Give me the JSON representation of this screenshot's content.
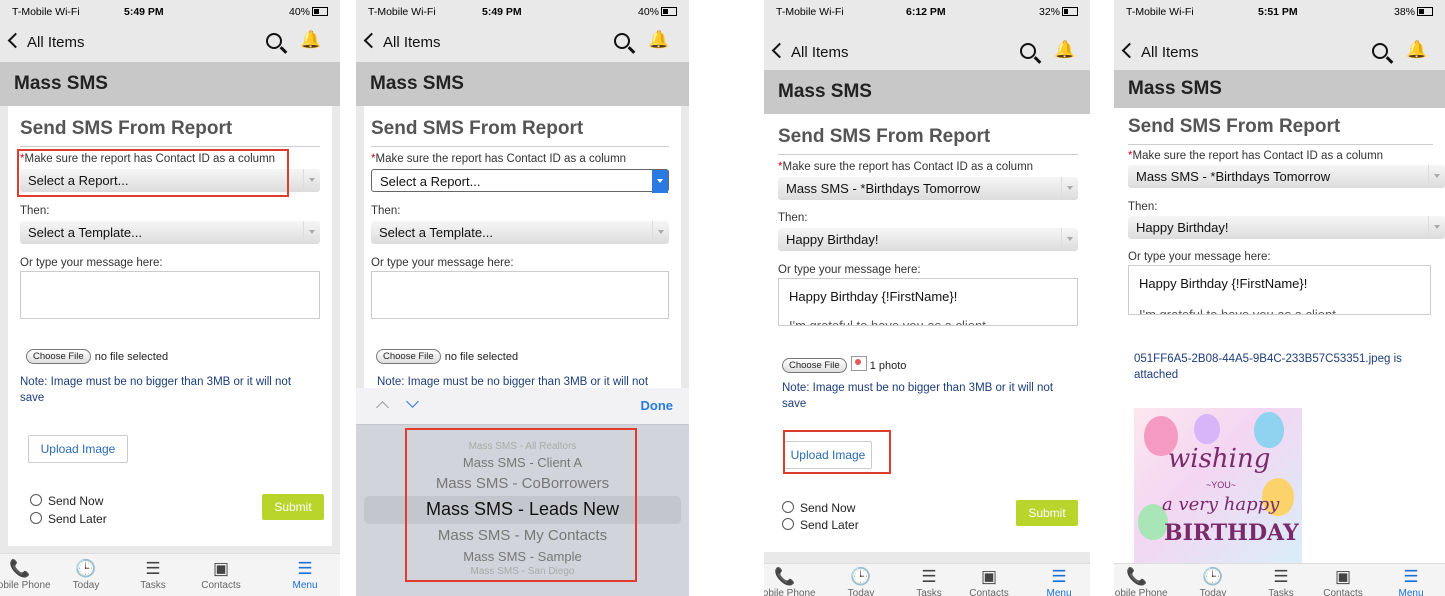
{
  "common": {
    "back_label": "All Items",
    "page_title": "Mass SMS",
    "card_title": "Send SMS From Report",
    "required_mark": "*",
    "report_hint": "Make sure the report has Contact ID as a column",
    "then_label": "Then:",
    "message_label": "Or type your message here:",
    "choose_file": "Choose File",
    "note": "Note: Image must be no bigger than 3MB or it will not save",
    "upload_button": "Upload Image",
    "send_now": "Send Now",
    "send_later": "Send Later",
    "submit": "Submit",
    "tabs": [
      "Mobile Phone",
      "Today",
      "Tasks",
      "Contacts",
      "Menu"
    ],
    "accent_color": "#b9d42a",
    "highlight_color": "#e03c2d",
    "link_color": "#1a6fd8"
  },
  "phones": [
    {
      "carrier": "T-Mobile Wi-Fi",
      "time": "5:49 PM",
      "battery": "40%",
      "report_value": "Select a Report...",
      "template_value": "Select a Template...",
      "file_status": "no file selected"
    },
    {
      "carrier": "T-Mobile Wi-Fi",
      "time": "5:49 PM",
      "battery": "40%",
      "report_value": "Select a Report...",
      "template_value": "Select a Template...",
      "file_status": "no file selected",
      "picker": {
        "done": "Done",
        "items": [
          "Mass SMS - All Realtors",
          "Mass SMS - Client A",
          "Mass SMS - CoBorrowers",
          "Mass SMS - Leads New",
          "Mass SMS - My Contacts",
          "Mass SMS - Sample",
          "Mass SMS - San Diego"
        ],
        "selected": "Mass SMS - Leads New"
      }
    },
    {
      "carrier": "T-Mobile Wi-Fi",
      "time": "6:12 PM",
      "battery": "32%",
      "report_value": "Mass SMS - *Birthdays Tomorrow",
      "template_value": "Happy Birthday!",
      "message": "Happy Birthday {!FirstName}!",
      "message_more": "I'm grateful to have you as a client",
      "file_status": "1 photo"
    },
    {
      "carrier": "T-Mobile Wi-Fi",
      "time": "5:51 PM",
      "battery": "38%",
      "report_value": "Mass SMS - *Birthdays Tomorrow",
      "template_value": "Happy Birthday!",
      "message": "Happy Birthday {!FirstName}!",
      "message_more": "I'm grateful to have you as a client",
      "attached_text": "051FF6A5-2B08-44A5-9B4C-233B57C53351.jpeg is attached",
      "image_text": {
        "line1": "wishing",
        "line2": "~YOU~",
        "line3": "a very happy",
        "line4": "BIRTHDAY"
      }
    }
  ]
}
